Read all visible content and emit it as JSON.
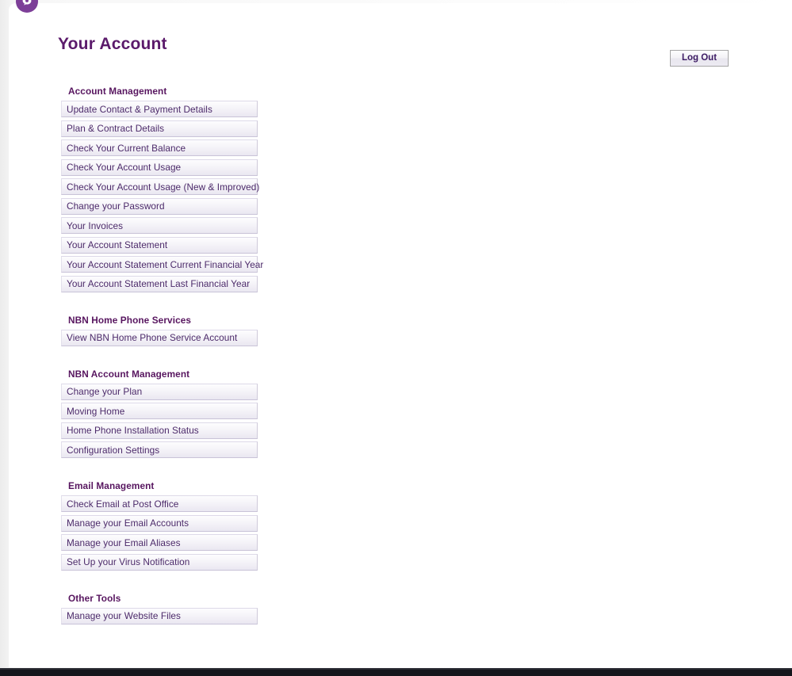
{
  "window": {
    "logo_icon": "purple-circle-logo-icon",
    "accent_color": "#5b1a6b",
    "logo_color": "#7d3f98",
    "item_text_color": "#4c2a6a",
    "heading_color": "#57155f"
  },
  "header": {
    "title": "Your Account",
    "logout_label": "Log Out"
  },
  "sections": [
    {
      "title": "Account Management",
      "items": [
        "Update Contact & Payment Details",
        "Plan & Contract Details",
        "Check Your Current Balance",
        "Check Your Account Usage",
        "Check Your Account Usage (New & Improved)",
        "Change your Password",
        "Your Invoices",
        "Your Account Statement",
        "Your Account Statement Current Financial Year",
        "Your Account Statement Last Financial Year"
      ]
    },
    {
      "title": "NBN Home Phone Services",
      "items": [
        "View NBN Home Phone Service Account"
      ]
    },
    {
      "title": "NBN Account Management",
      "items": [
        "Change your Plan",
        "Moving Home",
        "Home Phone Installation Status",
        "Configuration Settings"
      ]
    },
    {
      "title": "Email Management",
      "items": [
        "Check Email at Post Office",
        "Manage your Email Accounts",
        "Manage your Email Aliases",
        "Set Up your Virus Notification"
      ]
    },
    {
      "title": "Other Tools",
      "items": [
        "Manage your Website Files"
      ]
    }
  ]
}
